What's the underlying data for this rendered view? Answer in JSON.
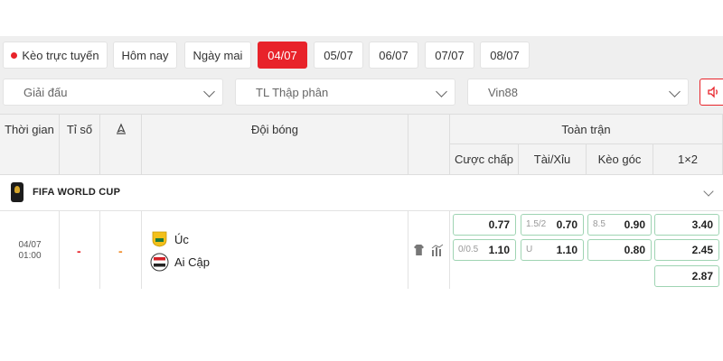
{
  "date_tabs": [
    {
      "label": "Kèo trực tuyến",
      "active": false,
      "live": true
    },
    {
      "label": "Hôm nay",
      "active": false
    },
    {
      "label": "Ngày mai",
      "active": false
    },
    {
      "label": "04/07",
      "active": true
    },
    {
      "label": "05/07",
      "active": false
    },
    {
      "label": "06/07",
      "active": false
    },
    {
      "label": "07/07",
      "active": false
    },
    {
      "label": "08/07",
      "active": false
    }
  ],
  "filters": {
    "league": "Giải đấu",
    "odds_format": "TL Thập phân",
    "bookmaker": "Vin88"
  },
  "table_header": {
    "time": "Thời gian",
    "score": "Tỉ số",
    "teams": "Đội bóng",
    "full_match": "Toàn trận",
    "handicap": "Cược chấp",
    "over_under": "Tài/Xỉu",
    "corners": "Kèo góc",
    "one_x_two": "1×2"
  },
  "league": {
    "name": "FIFA WORLD CUP"
  },
  "match": {
    "date": "04/07",
    "time": "01:00",
    "score_home": "-",
    "score_away": "-",
    "home_team": "Úc",
    "away_team": "Ai Cập",
    "odds": {
      "handicap": [
        {
          "label": "",
          "value": "0.77"
        },
        {
          "label": "0/0.5",
          "value": "1.10"
        }
      ],
      "over_under": [
        {
          "label": "1.5/2",
          "value": "0.70"
        },
        {
          "label": "U",
          "value": "1.10"
        }
      ],
      "corners": [
        {
          "label": "8.5",
          "value": "0.90"
        },
        {
          "label": "",
          "value": "0.80"
        }
      ],
      "one_x_two": [
        "3.40",
        "2.45",
        "2.87"
      ]
    }
  },
  "colors": {
    "accent": "#e8232a",
    "odds_border": "#9fd4b3",
    "score_home": "#e8232a",
    "score_away": "#f08c2a",
    "panel_bg": "#efefef"
  }
}
